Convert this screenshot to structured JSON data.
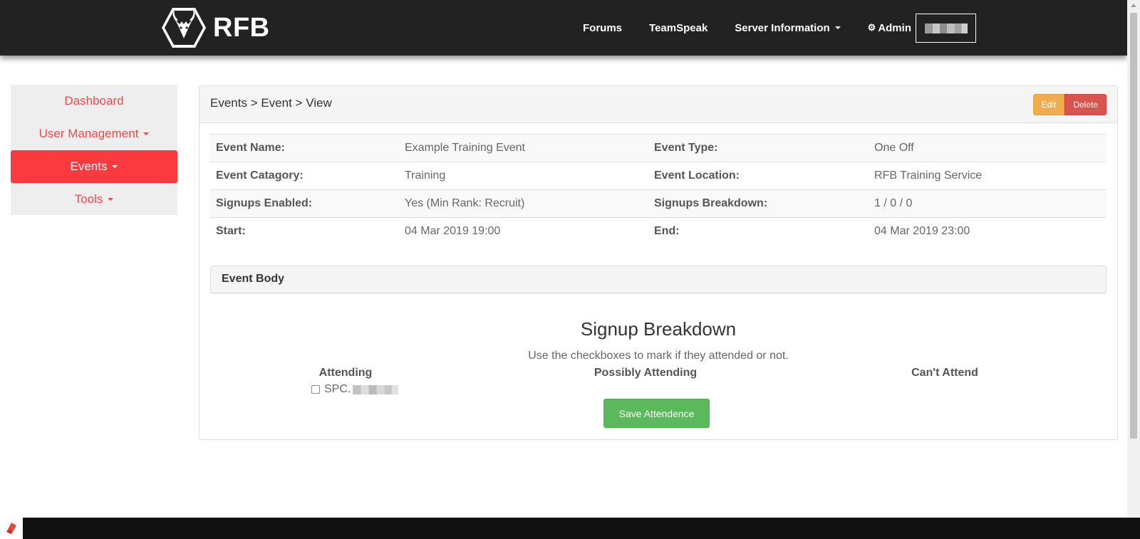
{
  "brand": {
    "name": "RFB"
  },
  "nav": {
    "forums": "Forums",
    "teamspeak": "TeamSpeak",
    "server_info": "Server Information",
    "admin": "Admin"
  },
  "sidebar": {
    "items": [
      {
        "label": "Dashboard"
      },
      {
        "label": "User Management"
      },
      {
        "label": "Events"
      },
      {
        "label": "Tools"
      }
    ]
  },
  "panel": {
    "breadcrumb": "Events > Event > View",
    "edit_label": "Edit",
    "delete_label": "Delete"
  },
  "event": {
    "rows": [
      {
        "k1": "Event Name:",
        "v1": "Example Training Event",
        "k2": "Event Type:",
        "v2": "One Off"
      },
      {
        "k1": "Event Catagory:",
        "v1": "Training",
        "k2": "Event Location:",
        "v2": "RFB Training Service"
      },
      {
        "k1": "Signups Enabled:",
        "v1": "Yes (Min Rank: Recruit)",
        "k2": "Signups Breakdown:",
        "v2": "1 / 0 / 0"
      },
      {
        "k1": "Start:",
        "v1": "04 Mar 2019 19:00",
        "k2": "End:",
        "v2": "04 Mar 2019 23:00"
      }
    ],
    "body_label": "Event Body"
  },
  "signup": {
    "title": "Signup Breakdown",
    "subtitle": "Use the checkboxes to mark if they attended or not.",
    "columns": [
      "Attending",
      "Possibly Attending",
      "Can't Attend"
    ],
    "attendee_rank": "SPC.",
    "save_label": "Save Attendence"
  },
  "colors": {
    "navbar": "#222222",
    "accent_red": "#fb3a3f",
    "edit": "#f0ad4e",
    "delete": "#d9534f",
    "save": "#5cb85c"
  }
}
